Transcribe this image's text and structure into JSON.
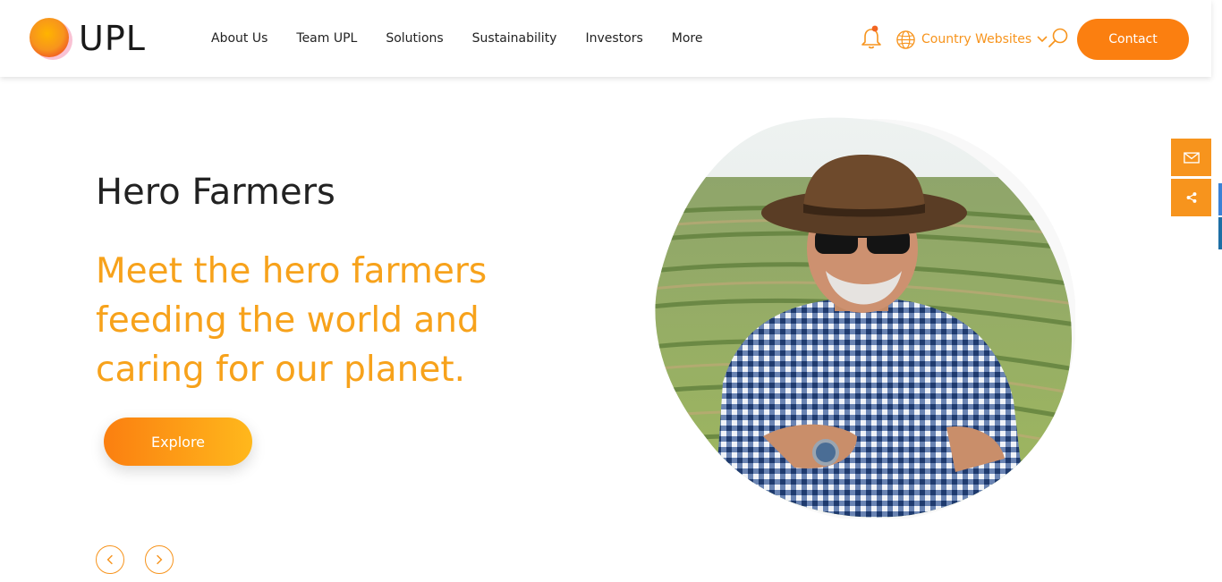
{
  "brand": {
    "name": "UPL",
    "accent": "#f7941d",
    "accent_dark": "#fb7f10"
  },
  "nav": {
    "items": [
      {
        "label": "About Us"
      },
      {
        "label": "Team UPL"
      },
      {
        "label": "Solutions"
      },
      {
        "label": "Sustainability"
      },
      {
        "label": "Investors"
      },
      {
        "label": "More"
      }
    ],
    "country_label": "Country Websites",
    "contact_label": "Contact",
    "icons": [
      "bell-icon",
      "globe-icon",
      "chevron-down-icon",
      "search-icon"
    ]
  },
  "hero": {
    "title": "Hero Farmers",
    "subtitle": "Meet the hero farmers feeding the world and caring for our planet.",
    "cta_label": "Explore"
  },
  "carousel": {
    "icons": [
      "chevron-left-icon",
      "chevron-right-icon"
    ]
  },
  "side_widgets": {
    "icons": [
      "mail-icon",
      "share-icon"
    ]
  }
}
